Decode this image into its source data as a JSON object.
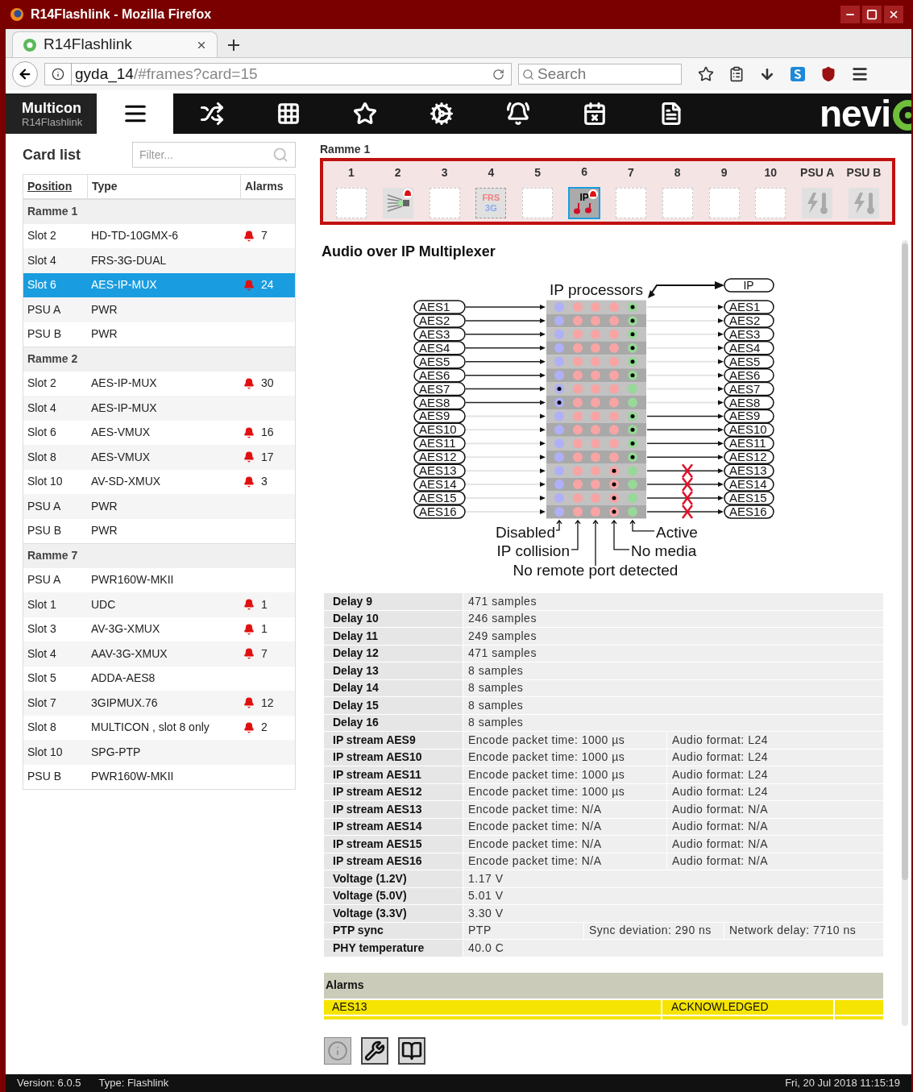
{
  "window": {
    "title": "R14Flashlink - Mozilla Firefox"
  },
  "browser": {
    "tab": "R14Flashlink",
    "url_host": "gyda_14",
    "url_path": "/#frames?card=15",
    "search_placeholder": "Search"
  },
  "app_nav": {
    "brand": "Multicon",
    "subtitle": "R14Flashlink",
    "logo": "nevi",
    "tabs": [
      {
        "kind": "list",
        "selected": true
      },
      {
        "kind": "shuffle",
        "selected": false
      },
      {
        "kind": "grid",
        "selected": false
      },
      {
        "kind": "star",
        "selected": false
      },
      {
        "kind": "cogs",
        "selected": false
      },
      {
        "kind": "bell",
        "selected": false
      },
      {
        "kind": "calendar",
        "selected": false
      },
      {
        "kind": "document",
        "selected": false
      }
    ]
  },
  "card_list": {
    "title": "Card list",
    "filter_placeholder": "Filter...",
    "columns": [
      "Position",
      "Type",
      "Alarms"
    ],
    "rows": [
      {
        "kind": "group",
        "label": "Ramme 1"
      },
      {
        "kind": "card",
        "position": "Slot 2",
        "type": "HD-TD-10GMX-6",
        "alarms": "7",
        "selected": false
      },
      {
        "kind": "card",
        "position": "Slot 4",
        "type": "FRS-3G-DUAL",
        "selected": false
      },
      {
        "kind": "card",
        "position": "Slot 6",
        "type": "AES-IP-MUX",
        "alarms": "24",
        "selected": true
      },
      {
        "kind": "card",
        "position": "PSU A",
        "type": "PWR",
        "selected": false
      },
      {
        "kind": "card",
        "position": "PSU B",
        "type": "PWR",
        "selected": false
      },
      {
        "kind": "group",
        "label": "Ramme 2"
      },
      {
        "kind": "card",
        "position": "Slot 2",
        "type": "AES-IP-MUX",
        "alarms": "30",
        "selected": false
      },
      {
        "kind": "card",
        "position": "Slot 4",
        "type": "AES-IP-MUX",
        "selected": false
      },
      {
        "kind": "card",
        "position": "Slot 6",
        "type": "AES-VMUX",
        "alarms": "16",
        "selected": false
      },
      {
        "kind": "card",
        "position": "Slot 8",
        "type": "AES-VMUX",
        "alarms": "17",
        "selected": false
      },
      {
        "kind": "card",
        "position": "Slot 10",
        "type": "AV-SD-XMUX",
        "alarms": "3",
        "selected": false
      },
      {
        "kind": "card",
        "position": "PSU A",
        "type": "PWR",
        "selected": false
      },
      {
        "kind": "card",
        "position": "PSU B",
        "type": "PWR",
        "selected": false
      },
      {
        "kind": "group",
        "label": "Ramme 7"
      },
      {
        "kind": "card",
        "position": "PSU A",
        "type": "PWR160W-MKII",
        "selected": false
      },
      {
        "kind": "card",
        "position": "Slot 1",
        "type": "UDC",
        "alarms": "1",
        "selected": false
      },
      {
        "kind": "card",
        "position": "Slot 3",
        "type": "AV-3G-XMUX",
        "alarms": "1",
        "selected": false
      },
      {
        "kind": "card",
        "position": "Slot 4",
        "type": "AAV-3G-XMUX",
        "alarms": "7",
        "selected": false
      },
      {
        "kind": "card",
        "position": "Slot 5",
        "type": "ADDA-AES8",
        "selected": false
      },
      {
        "kind": "card",
        "position": "Slot 7",
        "type": "3GIPMUX.76",
        "alarms": "12",
        "selected": false
      },
      {
        "kind": "card",
        "position": "Slot 8",
        "type": "MULTICON , slot 8 only",
        "alarms": "2",
        "selected": false
      },
      {
        "kind": "card",
        "position": "Slot 10",
        "type": "SPG-PTP",
        "selected": false
      },
      {
        "kind": "card",
        "position": "PSU B",
        "type": "PWR160W-MKII",
        "selected": false
      }
    ]
  },
  "frame": {
    "title": "Ramme 1",
    "slots": [
      {
        "label": "1",
        "kind": "empty",
        "selected": false
      },
      {
        "label": "2",
        "kind": "mux",
        "alarm": true,
        "selected": false
      },
      {
        "label": "3",
        "kind": "empty",
        "selected": false
      },
      {
        "label": "4",
        "kind": "frs",
        "texts": [
          "FRS",
          "3G"
        ],
        "selected": false
      },
      {
        "label": "5",
        "kind": "empty",
        "selected": false
      },
      {
        "label": "6",
        "kind": "ip",
        "texts": [
          "IP"
        ],
        "alarm": true,
        "selected": true
      },
      {
        "label": "7",
        "kind": "empty",
        "selected": false
      },
      {
        "label": "8",
        "kind": "empty",
        "selected": false
      },
      {
        "label": "9",
        "kind": "empty",
        "selected": false
      },
      {
        "label": "10",
        "kind": "empty",
        "selected": false
      },
      {
        "label": "PSU A",
        "kind": "psu",
        "selected": false
      },
      {
        "label": "PSU B",
        "kind": "psu",
        "selected": false
      }
    ]
  },
  "card": {
    "title": "Audio over IP Multiplexer",
    "diagram": {
      "title": "IP processors",
      "ip_label": "IP",
      "legend": [
        "Disabled",
        "Active",
        "IP collision",
        "No media",
        "No remote port detected"
      ],
      "rows": [
        {
          "input": "AES1",
          "output": "AES1",
          "input_active": true,
          "output_active": false,
          "kind": "active",
          "crossed": false
        },
        {
          "input": "AES2",
          "output": "AES2",
          "input_active": true,
          "output_active": false,
          "kind": "active",
          "crossed": false
        },
        {
          "input": "AES3",
          "output": "AES3",
          "input_active": true,
          "output_active": false,
          "kind": "active",
          "crossed": false
        },
        {
          "input": "AES4",
          "output": "AES4",
          "input_active": true,
          "output_active": false,
          "kind": "active",
          "crossed": false
        },
        {
          "input": "AES5",
          "output": "AES5",
          "input_active": true,
          "output_active": false,
          "kind": "active",
          "crossed": false
        },
        {
          "input": "AES6",
          "output": "AES6",
          "input_active": true,
          "output_active": false,
          "kind": "active",
          "crossed": false
        },
        {
          "input": "AES7",
          "output": "AES7",
          "input_active": true,
          "output_active": false,
          "kind": "disabled",
          "crossed": false
        },
        {
          "input": "AES8",
          "output": "AES8",
          "input_active": true,
          "output_active": false,
          "kind": "disabled",
          "crossed": false
        },
        {
          "input": "AES9",
          "output": "AES9",
          "input_active": false,
          "output_active": true,
          "kind": "active",
          "crossed": false
        },
        {
          "input": "AES10",
          "output": "AES10",
          "input_active": false,
          "output_active": true,
          "kind": "active",
          "crossed": false
        },
        {
          "input": "AES11",
          "output": "AES11",
          "input_active": false,
          "output_active": true,
          "kind": "active",
          "crossed": false
        },
        {
          "input": "AES12",
          "output": "AES12",
          "input_active": false,
          "output_active": true,
          "kind": "active",
          "crossed": false
        },
        {
          "input": "AES13",
          "output": "AES13",
          "input_active": false,
          "output_active": true,
          "kind": "nomedia",
          "crossed": true
        },
        {
          "input": "AES14",
          "output": "AES14",
          "input_active": false,
          "output_active": true,
          "kind": "nomedia",
          "crossed": true
        },
        {
          "input": "AES15",
          "output": "AES15",
          "input_active": false,
          "output_active": true,
          "kind": "nomedia",
          "crossed": true
        },
        {
          "input": "AES16",
          "output": "AES16",
          "input_active": false,
          "output_active": true,
          "kind": "nomedia",
          "crossed": true
        }
      ]
    },
    "parameters": [
      {
        "label": "Delay 9",
        "values": [
          "471 samples"
        ]
      },
      {
        "label": "Delay 10",
        "values": [
          "246 samples"
        ]
      },
      {
        "label": "Delay 11",
        "values": [
          "249 samples"
        ]
      },
      {
        "label": "Delay 12",
        "values": [
          "471 samples"
        ]
      },
      {
        "label": "Delay 13",
        "values": [
          "8 samples"
        ]
      },
      {
        "label": "Delay 14",
        "values": [
          "8 samples"
        ]
      },
      {
        "label": "Delay 15",
        "values": [
          "8 samples"
        ]
      },
      {
        "label": "Delay 16",
        "values": [
          "8 samples"
        ]
      },
      {
        "label": "IP stream AES9",
        "values": [
          "Encode packet time: 1000 µs",
          "Audio format: L24"
        ]
      },
      {
        "label": "IP stream AES10",
        "values": [
          "Encode packet time: 1000 µs",
          "Audio format: L24"
        ]
      },
      {
        "label": "IP stream AES11",
        "values": [
          "Encode packet time: 1000 µs",
          "Audio format: L24"
        ]
      },
      {
        "label": "IP stream AES12",
        "values": [
          "Encode packet time: 1000 µs",
          "Audio format: L24"
        ]
      },
      {
        "label": "IP stream AES13",
        "values": [
          "Encode packet time: N/A",
          "Audio format: N/A"
        ]
      },
      {
        "label": "IP stream AES14",
        "values": [
          "Encode packet time: N/A",
          "Audio format: N/A"
        ]
      },
      {
        "label": "IP stream AES15",
        "values": [
          "Encode packet time: N/A",
          "Audio format: N/A"
        ]
      },
      {
        "label": "IP stream AES16",
        "values": [
          "Encode packet time: N/A",
          "Audio format: N/A"
        ]
      },
      {
        "label": "Voltage (1.2V)",
        "values": [
          "1.17 V"
        ]
      },
      {
        "label": "Voltage (5.0V)",
        "values": [
          "5.01 V"
        ]
      },
      {
        "label": "Voltage (3.3V)",
        "values": [
          "3.30 V"
        ]
      },
      {
        "label": "PTP sync",
        "values": [
          "PTP",
          "Sync deviation: 290 ns",
          "Network delay: 7710 ns"
        ]
      },
      {
        "label": "PHY temperature",
        "values": [
          "40.0 C"
        ]
      }
    ],
    "alarms": {
      "title": "Alarms",
      "rows": [
        {
          "name": "AES13",
          "status": "ACKNOWLEDGED"
        }
      ]
    },
    "tools": [
      {
        "kind": "info",
        "selected": true
      },
      {
        "kind": "wrench",
        "selected": false
      },
      {
        "kind": "book",
        "selected": false
      }
    ]
  },
  "status_bar": {
    "version": "Version: 6.0.5",
    "type": "Type: Flashlink",
    "time": "Fri, 20 Jul 2018 11:15:19"
  }
}
